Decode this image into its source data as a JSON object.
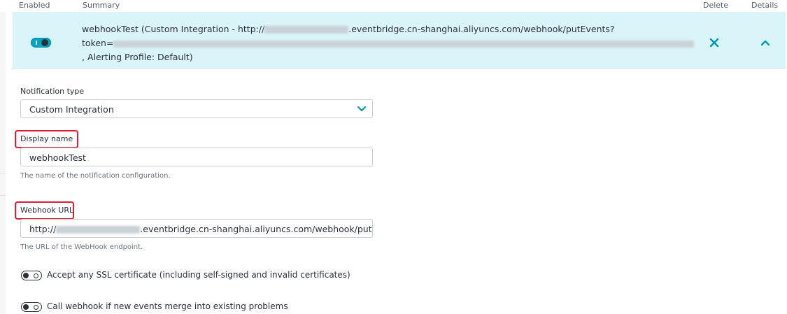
{
  "header": {
    "enabled": "Enabled",
    "summary": "Summary",
    "delete": "Delete",
    "details": "Details"
  },
  "row": {
    "line1_prefix": "webhookTest (Custom Integration - http://",
    "line1_suffix": ".eventbridge.cn-shanghai.aliyuncs.com/webhook/putEvents?",
    "line2_prefix": "token=",
    "line3": ", Alerting Profile: Default)",
    "delete_icon": "close-icon",
    "collapse_icon": "chevron-up-icon"
  },
  "form": {
    "notification_type_label": "Notification type",
    "notification_type_value": "Custom Integration",
    "display_name_label": "Display name",
    "display_name_value": "webhookTest",
    "display_name_hint": "The name of the notification configuration.",
    "webhook_url_label": "Webhook URL",
    "webhook_url_prefix": "http://",
    "webhook_url_suffix": ".eventbridge.cn-shanghai.aliyuncs.com/webhook/putEvents?tok",
    "webhook_url_hint": "The URL of the WebHook endpoint.",
    "accept_ssl_label": "Accept any SSL certificate (including self-signed and invalid certificates)",
    "call_webhook_label": "Call webhook if new events merge into existing problems"
  },
  "colors": {
    "accent": "#00a6c2",
    "row_bg": "#daf5f9",
    "highlight": "#dc1e35"
  }
}
